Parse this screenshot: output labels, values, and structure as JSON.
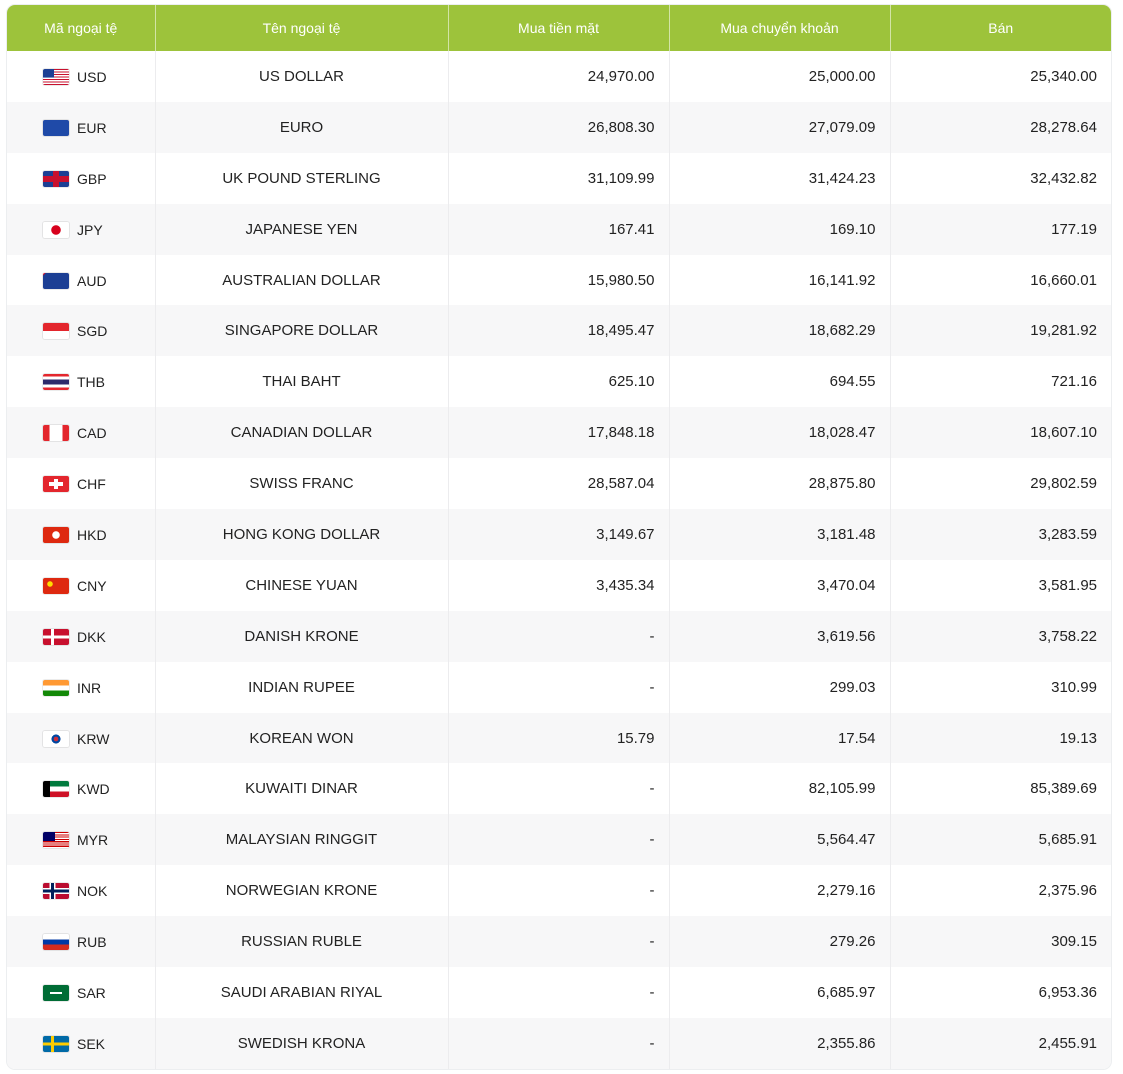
{
  "header": {
    "code": "Mã ngoại tệ",
    "name": "Tên ngoại tệ",
    "cash_buy": "Mua tiền mặt",
    "transfer_buy": "Mua chuyển khoản",
    "sell": "Bán"
  },
  "rows": [
    {
      "code": "USD",
      "name": "US DOLLAR",
      "cash": "24,970.00",
      "transfer": "25,000.00",
      "sell": "25,340.00",
      "flag": "flag-us-icon",
      "flag_css": "repeating-linear-gradient(180deg,#c8102e 0 1.23px,#fff 1.23px 2.46px)",
      "flag_canton": "#1c3f94"
    },
    {
      "code": "EUR",
      "name": "EURO",
      "cash": "26,808.30",
      "transfer": "27,079.09",
      "sell": "28,278.64",
      "flag": "flag-eu-icon",
      "flag_css": "#1f4aa8"
    },
    {
      "code": "GBP",
      "name": "UK POUND STERLING",
      "cash": "31,109.99",
      "transfer": "31,424.23",
      "sell": "32,432.82",
      "flag": "flag-uk-icon",
      "flag_css": "linear-gradient(90deg,transparent 10px,#c8102e 10px 16px,transparent 16px),linear-gradient(180deg,transparent 5px,#c8102e 5px 11px,transparent 11px),#1c3f94"
    },
    {
      "code": "JPY",
      "name": "JAPANESE YEN",
      "cash": "167.41",
      "transfer": "169.10",
      "sell": "177.19",
      "flag": "flag-jp-icon",
      "flag_css": "radial-gradient(circle at 50% 50%,#d7001c 0 4.5px,#ffffff 5px)"
    },
    {
      "code": "AUD",
      "name": "AUSTRALIAN DOLLAR",
      "cash": "15,980.50",
      "transfer": "16,141.92",
      "sell": "16,660.01",
      "flag": "flag-au-icon",
      "flag_css": "linear-gradient(135deg,#c8102e 0 2px,transparent 2px),#1c3f94"
    },
    {
      "code": "SGD",
      "name": "SINGAPORE DOLLAR",
      "cash": "18,495.47",
      "transfer": "18,682.29",
      "sell": "19,281.92",
      "flag": "flag-sg-icon",
      "flag_css": "linear-gradient(180deg,#e3262d 0 50%,#ffffff 50% 100%)"
    },
    {
      "code": "THB",
      "name": "THAI BAHT",
      "cash": "625.10",
      "transfer": "694.55",
      "sell": "721.16",
      "flag": "flag-th-icon",
      "flag_css": "linear-gradient(180deg,#e3262d 0 16.6%,#fff 16.6% 33.3%,#2d2a6b 33.3% 66.6%,#fff 66.6% 83.3%,#e3262d 83.3%)"
    },
    {
      "code": "CAD",
      "name": "CANADIAN DOLLAR",
      "cash": "17,848.18",
      "transfer": "18,028.47",
      "sell": "18,607.10",
      "flag": "flag-ca-icon",
      "flag_css": "linear-gradient(90deg,#e3262d 0 25%,#fff 25% 75%,#e3262d 75%)"
    },
    {
      "code": "CHF",
      "name": "SWISS FRANC",
      "cash": "28,587.04",
      "transfer": "28,875.80",
      "sell": "29,802.59",
      "flag": "flag-ch-icon",
      "flag_css": "linear-gradient(90deg,transparent 11px,#fff 11px 15px,transparent 15px) center/26px 10px no-repeat,linear-gradient(180deg,transparent 6px,#fff 6px 10px,transparent 10px) center/14px 16px no-repeat,#e3262d"
    },
    {
      "code": "HKD",
      "name": "HONG KONG DOLLAR",
      "cash": "3,149.67",
      "transfer": "3,181.48",
      "sell": "3,283.59",
      "flag": "flag-hk-icon",
      "flag_css": "radial-gradient(circle at 50% 50%,#fff 0 3.5px,#de2910 4px)"
    },
    {
      "code": "CNY",
      "name": "CHINESE YUAN",
      "cash": "3,435.34",
      "transfer": "3,470.04",
      "sell": "3,581.95",
      "flag": "flag-cn-icon",
      "flag_css": "radial-gradient(circle at 7px 6px,#ffde00 0 2.5px,#de2910 3px)"
    },
    {
      "code": "DKK",
      "name": "DANISH KRONE",
      "cash": "-",
      "transfer": "3,619.56",
      "sell": "3,758.22",
      "flag": "flag-dk-icon",
      "flag_css": "linear-gradient(90deg,transparent 8px,#fff 8px 11px,transparent 11px),linear-gradient(180deg,transparent 6.5px,#fff 6.5px 9.5px,transparent 9.5px),#c8102e"
    },
    {
      "code": "INR",
      "name": "INDIAN RUPEE",
      "cash": "-",
      "transfer": "299.03",
      "sell": "310.99",
      "flag": "flag-in-icon",
      "flag_css": "linear-gradient(180deg,#ff9933 0 33.3%,#ffffff 33.3% 66.6%,#138808 66.6%)"
    },
    {
      "code": "KRW",
      "name": "KOREAN WON",
      "cash": "15.79",
      "transfer": "17.54",
      "sell": "19.13",
      "flag": "flag-kr-icon",
      "flag_css": "radial-gradient(circle at 50% 50%,#cd2e3a 0 2.2px,#0047a0 2.4px 4.4px,#fff 4.6px)"
    },
    {
      "code": "KWD",
      "name": "KUWAITI DINAR",
      "cash": "-",
      "transfer": "82,105.99",
      "sell": "85,389.69",
      "flag": "flag-kw-icon",
      "flag_css": "linear-gradient(90deg,#000 0 7px,transparent 7px),linear-gradient(180deg,#007a3d 0 33.3%,#fff 33.3% 66.6%,#ce1126 66.6%)"
    },
    {
      "code": "MYR",
      "name": "MALAYSIAN RINGGIT",
      "cash": "-",
      "transfer": "5,564.47",
      "sell": "5,685.91",
      "flag": "flag-my-icon",
      "flag_css": "linear-gradient(90deg,#010066 0 12px,transparent 12px) top left/26px 9px no-repeat,repeating-linear-gradient(180deg,#cc0001 0 1.14px,#fff 1.14px 2.28px)"
    },
    {
      "code": "NOK",
      "name": "NORWEGIAN KRONE",
      "cash": "-",
      "transfer": "2,279.16",
      "sell": "2,375.96",
      "flag": "flag-no-icon",
      "flag_css": "linear-gradient(90deg,transparent 8px,#00205b 8px 11px,transparent 11px),linear-gradient(180deg,transparent 6.5px,#00205b 6.5px 9.5px,transparent 9.5px),linear-gradient(90deg,transparent 6.5px,#fff 6.5px 12.5px,transparent 12.5px),linear-gradient(180deg,transparent 5px,#fff 5px 11px,transparent 11px),#ba0c2f"
    },
    {
      "code": "RUB",
      "name": "RUSSIAN RUBLE",
      "cash": "-",
      "transfer": "279.26",
      "sell": "309.15",
      "flag": "flag-ru-icon",
      "flag_css": "linear-gradient(180deg,#ffffff 0 33.3%,#0039a6 33.3% 66.6%,#d52b1e 66.6%)"
    },
    {
      "code": "SAR",
      "name": "SAUDI ARABIAN RIYAL",
      "cash": "-",
      "transfer": "6,685.97",
      "sell": "6,953.36",
      "flag": "flag-sa-icon",
      "flag_css": "linear-gradient(90deg,transparent 7px,#fff 7px 19px,transparent 19px) center/26px 2px no-repeat,#006c35"
    },
    {
      "code": "SEK",
      "name": "SWEDISH KRONA",
      "cash": "-",
      "transfer": "2,355.86",
      "sell": "2,455.91",
      "flag": "flag-se-icon",
      "flag_css": "linear-gradient(90deg,transparent 8px,#fecc00 8px 11px,transparent 11px),linear-gradient(180deg,transparent 6.5px,#fecc00 6.5px 9.5px,transparent 9.5px),#006aa7"
    }
  ]
}
